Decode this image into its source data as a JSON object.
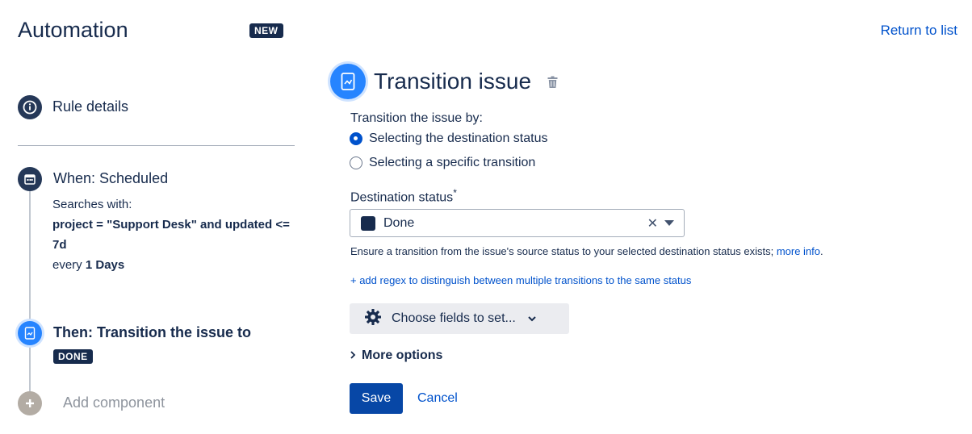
{
  "header": {
    "title": "Automation",
    "new_badge": "NEW",
    "return_link": "Return to list"
  },
  "rail": {
    "rule_details": "Rule details",
    "when_title": "When: Scheduled",
    "searches_label": "Searches with:",
    "query": "project = \"Support Desk\" and updated <= 7d",
    "every_prefix": "every",
    "every_value": "1 Days",
    "then_title": "Then: Transition the issue to",
    "then_status": "DONE",
    "add_component": "Add component"
  },
  "panel": {
    "title": "Transition issue",
    "transition_by_label": "Transition the issue by:",
    "radio_options": [
      {
        "label": "Selecting the destination status",
        "checked": true
      },
      {
        "label": "Selecting a specific transition",
        "checked": false
      }
    ],
    "destination_label": "Destination status",
    "required_mark": "*",
    "destination_value": "Done",
    "help_text": "Ensure a transition from the issue's source status to your selected destination status exists;",
    "help_link": "more info",
    "help_period": ".",
    "regex_link": "+ add regex to distinguish between multiple transitions to the same status",
    "fields_button": "Choose fields to set...",
    "more_options": "More options",
    "save": "Save",
    "cancel": "Cancel"
  },
  "colors": {
    "primary": "#0747a6",
    "link": "#0052cc",
    "text": "#172b4d",
    "node_blue": "#2684ff"
  }
}
